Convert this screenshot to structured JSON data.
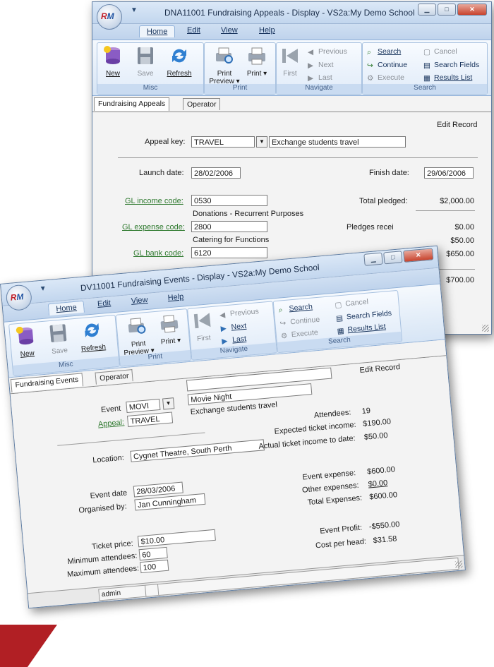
{
  "app": {
    "logo_r": "R",
    "logo_m": "M"
  },
  "ribbon": {
    "tabs": [
      "Home",
      "Edit",
      "View",
      "Help"
    ],
    "misc": {
      "new": "New",
      "save": "Save",
      "refresh": "Refresh"
    },
    "print": {
      "preview": "Print Preview ▾",
      "print": "Print ▾"
    },
    "navigate": {
      "first": "First",
      "previous": "Previous",
      "next": "Next",
      "last": "Last"
    },
    "search": {
      "search": "Search",
      "continue": "Continue",
      "execute": "Execute",
      "cancel": "Cancel",
      "fields": "Search Fields",
      "results": "Results List"
    },
    "groups": {
      "misc": "Misc",
      "print": "Print",
      "navigate": "Navigate",
      "search": "Search"
    }
  },
  "win1": {
    "title": "DNA11001 Fundraising Appeals - Display - VS2a:My Demo School",
    "tabs": [
      "Fundraising Appeals",
      "Operator"
    ],
    "mode": "Edit Record",
    "appeal_key": {
      "label": "Appeal key:",
      "value": "TRAVEL",
      "description": "Exchange students travel"
    },
    "launch_date": {
      "label": "Launch date:",
      "value": "28/02/2006"
    },
    "finish_date": {
      "label": "Finish date:",
      "value": "29/06/2006"
    },
    "gl_income": {
      "label": "GL income code:",
      "value": "0530",
      "description": "Donations - Recurrent Purposes"
    },
    "gl_expense": {
      "label": "GL expense code:",
      "value": "2800",
      "description": "Catering for Functions"
    },
    "gl_bank": {
      "label": "GL bank code:",
      "value": "6120"
    },
    "pledged": {
      "label": "Total pledged:",
      "value": "$2,000.00"
    },
    "pledges_received": {
      "label": "Pledges recei",
      "value": "$0.00"
    },
    "amounts": [
      "$50.00",
      "$650.00",
      "$700.00"
    ]
  },
  "win2": {
    "title": "DV11001 Fundraising Events - Display - VS2a:My Demo School",
    "tabs": [
      "Fundraising Events",
      "Operator"
    ],
    "mode": "Edit Record",
    "event": {
      "label": "Event",
      "value": "MOVI",
      "name": "Movie Night"
    },
    "appeal": {
      "label": "Appeal:",
      "value": "TRAVEL",
      "description": "Exchange students travel"
    },
    "attendees": {
      "label": "Attendees:",
      "value": "19"
    },
    "expected_income": {
      "label": "Expected ticket income:",
      "value": "$190.00"
    },
    "actual_income": {
      "label": "Actual ticket income to date:",
      "value": "$50.00"
    },
    "location": {
      "label": "Location:",
      "value": "Cygnet Theatre, South Perth"
    },
    "event_date": {
      "label": "Event date",
      "value": "28/03/2006"
    },
    "organised_by": {
      "label": "Organised by:",
      "value": "Jan Cunningham"
    },
    "event_expense": {
      "label": "Event expense:",
      "value": "$600.00"
    },
    "other_expenses": {
      "label": "Other expenses:",
      "value": "$0.00"
    },
    "total_expenses": {
      "label": "Total Expenses:",
      "value": "$600.00"
    },
    "ticket_price": {
      "label": "Ticket price:",
      "value": "$10.00"
    },
    "min_attendees": {
      "label": "Minimum attendees:",
      "value": "60"
    },
    "max_attendees": {
      "label": "Maximum attendees:",
      "value": "100"
    },
    "profit": {
      "label": "Event Profit:",
      "value": "-$550.00"
    },
    "cost_per_head": {
      "label": "Cost per head:",
      "value": "$31.58"
    },
    "status_user": "admin"
  },
  "colors": {
    "accent": "#b11f24",
    "link": "#2f7a2f",
    "ribbon": "#c9dbf1"
  }
}
